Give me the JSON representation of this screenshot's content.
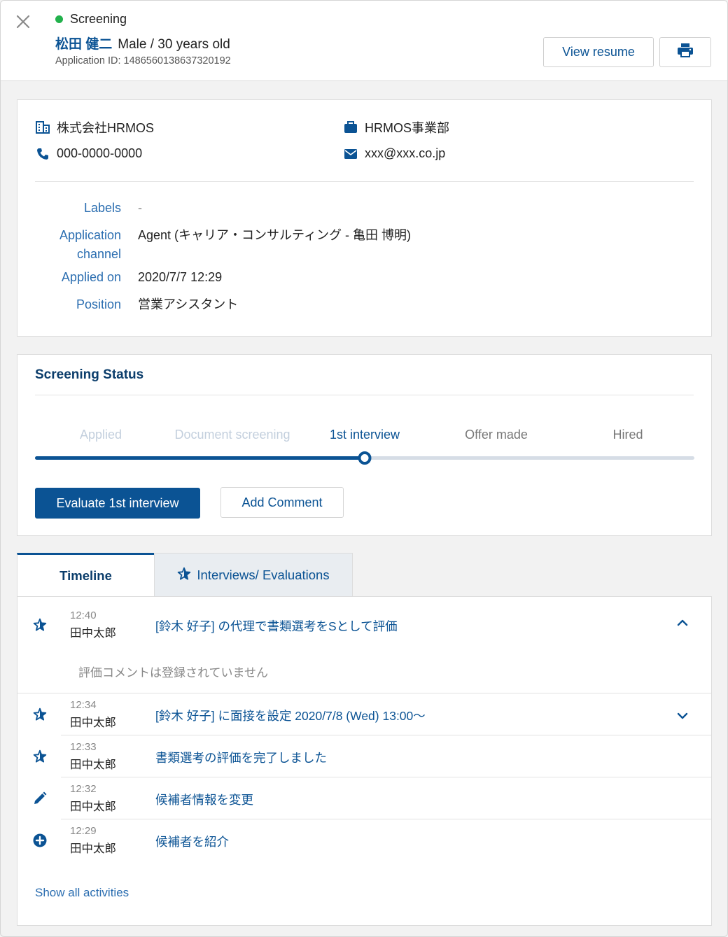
{
  "header": {
    "status": "Screening",
    "candidate_name": "松田 健二",
    "candidate_meta": "Male / 30 years old",
    "application_id": "Application ID: 1486560138637320192",
    "view_resume_label": "View resume",
    "status_color": "#22b14c"
  },
  "info": {
    "company": "株式会社HRMOS",
    "department": "HRMOS事業部",
    "phone": "000-0000-0000",
    "email": "xxx@xxx.co.jp",
    "fields": {
      "labels_label": "Labels",
      "labels_value": "-",
      "channel_label_1": "Application",
      "channel_label_2": "channel",
      "channel_value": "Agent (キャリア・コンサルティング - 亀田 博明)",
      "applied_label": "Applied on",
      "applied_value": "2020/7/7 12:29",
      "position_label": "Position",
      "position_value": "営業アシスタント"
    }
  },
  "screening": {
    "title": "Screening Status",
    "steps": [
      "Applied",
      "Document screening",
      "1st interview",
      "Offer made",
      "Hired"
    ],
    "current_step_index": 2,
    "evaluate_label": "Evaluate 1st interview",
    "comment_label": "Add Comment"
  },
  "tabs": {
    "timeline": "Timeline",
    "interviews": "Interviews/ Evaluations"
  },
  "timeline": {
    "items": [
      {
        "time": "12:40",
        "user": "田中太郎",
        "text": "[鈴木 好子] の代理で書類選考をSとして評価",
        "icon": "star-icon",
        "comment": "評価コメントは登録されていません"
      },
      {
        "time": "12:34",
        "user": "田中太郎",
        "text": "[鈴木 好子] に面接を設定  2020/7/8 (Wed) 13:00～",
        "icon": "star-icon"
      },
      {
        "time": "12:33",
        "user": "田中太郎",
        "text": "書類選考の評価を完了しました",
        "icon": "star-icon"
      },
      {
        "time": "12:32",
        "user": "田中太郎",
        "text": "候補者情報を変更",
        "icon": "pencil-icon"
      },
      {
        "time": "12:29",
        "user": "田中太郎",
        "text": "候補者を紹介",
        "icon": "plus-circle-icon"
      }
    ],
    "show_all_label": "Show all activities"
  }
}
